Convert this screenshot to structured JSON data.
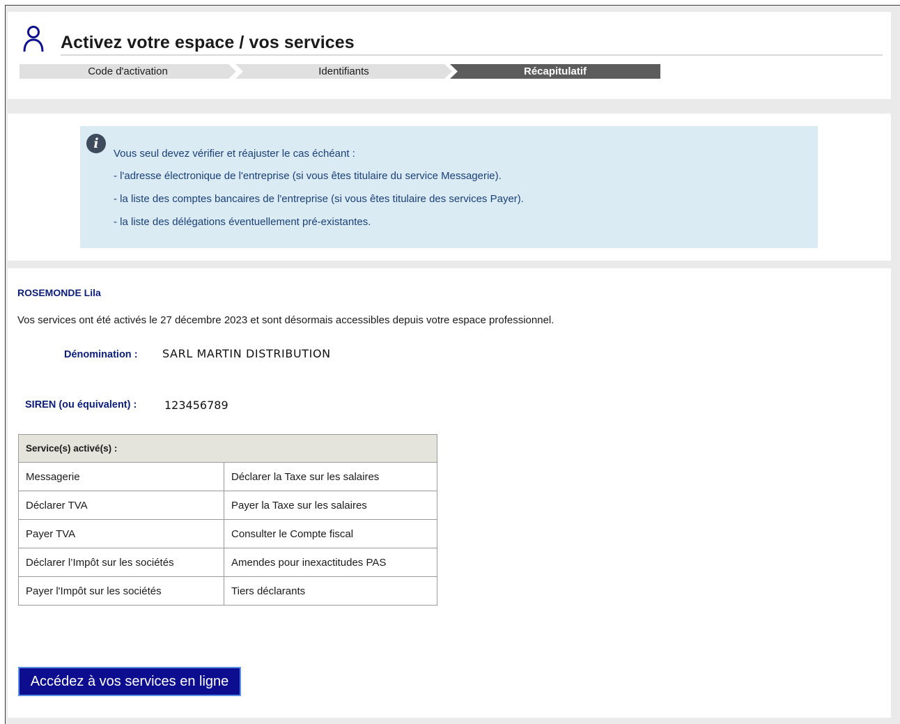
{
  "header": {
    "title": "Activez votre espace / vos services",
    "user_icon": "user-icon"
  },
  "steps": [
    {
      "label": "Code d'activation",
      "active": false
    },
    {
      "label": "Identifiants",
      "active": false
    },
    {
      "label": "Récapitulatif",
      "active": true
    }
  ],
  "info": {
    "icon": "info-icon",
    "lines": [
      "Vous seul devez vérifier et réajuster le cas échéant :",
      "- l'adresse électronique de l'entreprise (si vous êtes titulaire du service Messagerie).",
      "- la liste des comptes bancaires de l'entreprise (si vous êtes titulaire des services Payer).",
      "- la liste des délégations éventuellement pré-existantes."
    ]
  },
  "summary": {
    "user_name": "ROSEMONDE Lila",
    "activation_text": "Vos services ont été activés le 27 décembre 2023 et sont désormais accessibles depuis votre espace professionnel.",
    "denomination_label": "Dénomination :",
    "denomination_value": "SARL MARTIN DISTRIBUTION",
    "siren_label": "SIREN (ou équivalent) :",
    "siren_value": "123456789"
  },
  "services_table": {
    "header": "Service(s) activé(s) :",
    "rows": [
      [
        "Messagerie",
        "Déclarer la Taxe sur les salaires"
      ],
      [
        "Déclarer TVA",
        "Payer la Taxe sur les salaires"
      ],
      [
        "Payer TVA",
        "Consulter le Compte fiscal"
      ],
      [
        "Déclarer l’Impôt sur les sociétés",
        "Amendes pour inexactitudes PAS"
      ],
      [
        "Payer l'Impôt sur les sociétés",
        "Tiers déclarants"
      ]
    ]
  },
  "cta": {
    "label": "Accédez à vos services en ligne"
  },
  "colors": {
    "accent": "#0d0d8f",
    "label_blue": "#0b1d7a",
    "info_bg": "#daebf3",
    "step_active": "#5c5c5c"
  }
}
